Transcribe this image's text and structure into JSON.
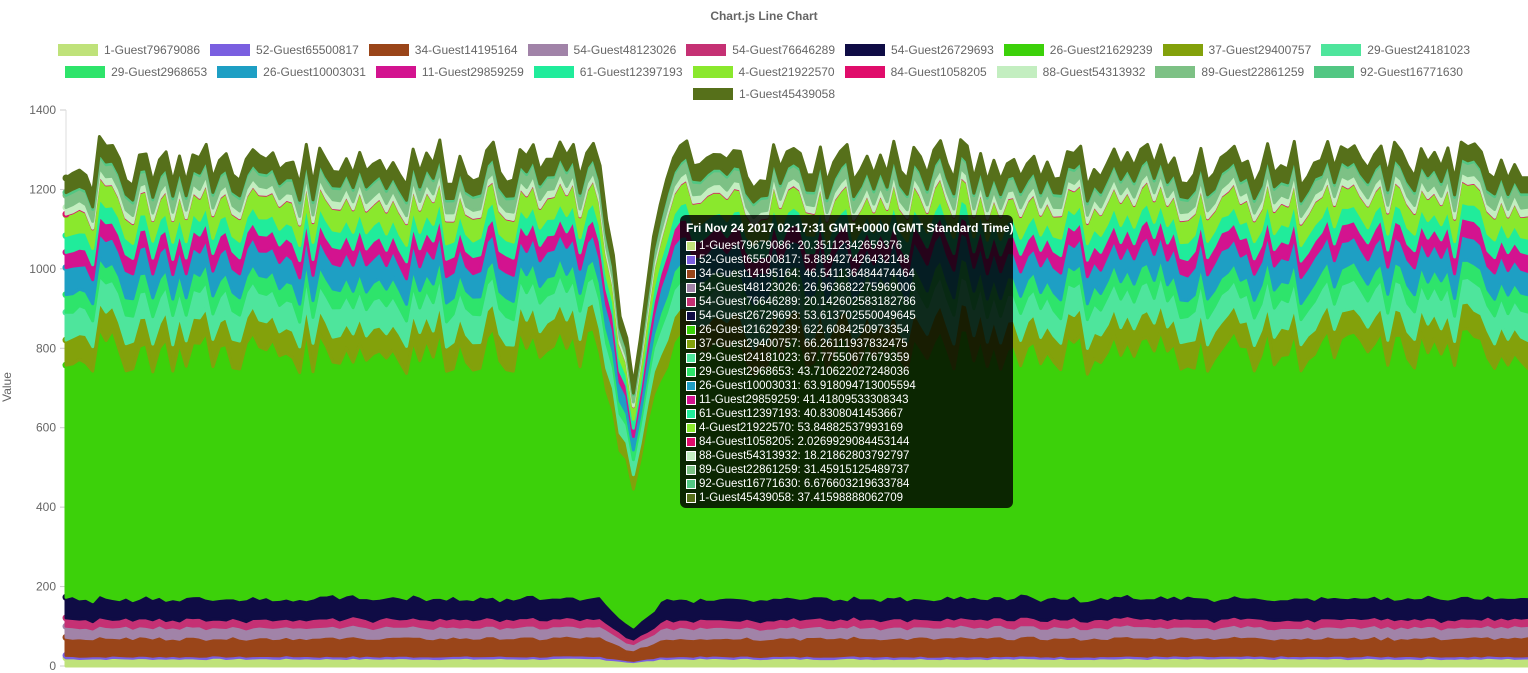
{
  "chart_data": {
    "type": "area",
    "stacked": true,
    "title": "Chart.js Line Chart",
    "ylabel": "Value",
    "xlabel": "",
    "ylim": [
      0,
      1400
    ],
    "yticks": [
      0,
      200,
      400,
      600,
      800,
      1000,
      1200,
      1400
    ],
    "grid": false,
    "legend_position": "top",
    "series": [
      {
        "name": "1-Guest79679086",
        "color": "#bfe27a",
        "value": 20.35
      },
      {
        "name": "52-Guest65500817",
        "color": "#7a5fe0",
        "value": 5.89
      },
      {
        "name": "34-Guest14195164",
        "color": "#9a4519",
        "value": 46.54
      },
      {
        "name": "54-Guest48123026",
        "color": "#a183a8",
        "value": 26.96
      },
      {
        "name": "54-Guest76646289",
        "color": "#c53174",
        "value": 20.14
      },
      {
        "name": "54-Guest26729693",
        "color": "#0f0c45",
        "value": 53.61
      },
      {
        "name": "26-Guest21629239",
        "color": "#3cd10a",
        "value": 622.61
      },
      {
        "name": "37-Guest29400757",
        "color": "#83a10b",
        "value": 66.26
      },
      {
        "name": "29-Guest24181023",
        "color": "#4ee59c",
        "value": 67.78
      },
      {
        "name": "29-Guest2968653",
        "color": "#2ee46b",
        "value": 43.71
      },
      {
        "name": "26-Guest10003031",
        "color": "#1e9fc4",
        "value": 63.92
      },
      {
        "name": "11-Guest29859259",
        "color": "#d3138f",
        "value": 41.42
      },
      {
        "name": "61-Guest12397193",
        "color": "#20ec9b",
        "value": 40.83
      },
      {
        "name": "4-Guest21922570",
        "color": "#8ae82d",
        "value": 53.85
      },
      {
        "name": "84-Guest1058205",
        "color": "#e00d6b",
        "value": 2.03
      },
      {
        "name": "88-Guest54313932",
        "color": "#c3eec0",
        "value": 18.22
      },
      {
        "name": "89-Guest22861259",
        "color": "#7dc185",
        "value": 31.46
      },
      {
        "name": "92-Guest16771630",
        "color": "#52c783",
        "value": 6.68
      },
      {
        "name": "1-Guest45439058",
        "color": "#56701a",
        "value": 37.42
      }
    ]
  },
  "tooltip": {
    "title": "Fri Nov 24 2017 02:17:31 GMT+0000 (GMT Standard Time)",
    "items": [
      {
        "label": "1-Guest79679086: 20.35112342659376"
      },
      {
        "label": "52-Guest65500817: 5.889427426432148"
      },
      {
        "label": "34-Guest14195164: 46.541136484474464"
      },
      {
        "label": "54-Guest48123026: 26.963682275969006"
      },
      {
        "label": "54-Guest76646289: 20.142602583182786"
      },
      {
        "label": "54-Guest26729693: 53.613702550049645"
      },
      {
        "label": "26-Guest21629239: 622.6084250973354"
      },
      {
        "label": "37-Guest29400757: 66.26111937832475"
      },
      {
        "label": "29-Guest24181023: 67.77550677679359"
      },
      {
        "label": "29-Guest2968653: 43.710622027248036"
      },
      {
        "label": "26-Guest10003031: 63.918094713005594"
      },
      {
        "label": "11-Guest29859259: 41.41809533308343"
      },
      {
        "label": "61-Guest12397193: 40.8308041453667"
      },
      {
        "label": "4-Guest21922570: 53.84882537993169"
      },
      {
        "label": "84-Guest1058205: 2.0269929084453144"
      },
      {
        "label": "88-Guest54313932: 18.21862803792797"
      },
      {
        "label": "89-Guest22861259: 31.45915125489737"
      },
      {
        "label": "92-Guest16771630: 6.676603219633784"
      },
      {
        "label": "1-Guest45439058: 37.41598888062709"
      }
    ]
  }
}
